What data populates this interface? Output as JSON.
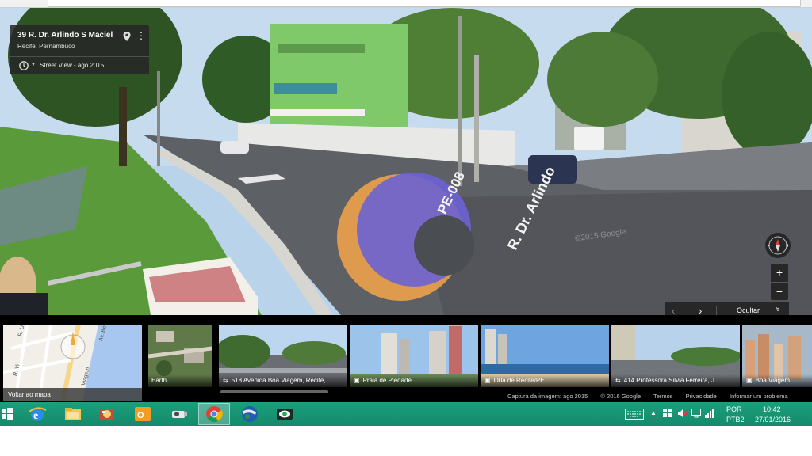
{
  "address_card": {
    "title": "39 R. Dr. Arlindo S Maciel",
    "subtitle": "Recife, Pernambuco",
    "street_view_label": "Street View - ago 2015"
  },
  "scene_labels": {
    "road_label_1": "PE-008",
    "road_label_2": "R. Dr. Arlindo",
    "watermark": "©2015 Google"
  },
  "controls": {
    "zoom_in": "+",
    "zoom_out": "−",
    "prev": "‹",
    "next": "›",
    "hide_label": "Ocultar",
    "collapse": "»"
  },
  "filmstrip": {
    "map_back_label": "Voltar ao mapa",
    "map_streets": [
      "R. Ulisses Mont.",
      "Av. Bo",
      "Viagem",
      "R. Vi"
    ],
    "thumbnails": [
      {
        "caption": "Earth",
        "icon": "none"
      },
      {
        "caption": "518 Avenida Boa Viagem, Recife,...",
        "icon": "streetview-arrows-icon"
      },
      {
        "caption": "Praia de Piedade",
        "icon": "photo-icon"
      },
      {
        "caption": "Orla de Recife/PE",
        "icon": "photo-icon"
      },
      {
        "caption": "414 Professora Silvia Ferreira, J...",
        "icon": "streetview-arrows-icon"
      },
      {
        "caption": "Boa Viagem",
        "icon": "photo-icon"
      }
    ],
    "footer": [
      "Captura da imagem: ago 2015",
      "© 2016 Google",
      "Termos",
      "Privacidade",
      "Informar um problema"
    ]
  },
  "taskbar": {
    "apps": [
      "windows-start-icon",
      "internet-explorer-icon",
      "file-explorer-icon",
      "media-app-icon",
      "office-app-icon",
      "camera-app-icon",
      "chrome-icon",
      "google-earth-icon",
      "eye-app-icon"
    ],
    "language": "POR",
    "layout": "PTB2",
    "time": "10:42",
    "date": "27/01/2016"
  },
  "colors": {
    "taskbar": "#1d9e7c",
    "sky": "#b9d3ea",
    "building_green": "#7fc96a",
    "road": "#5d6166"
  }
}
